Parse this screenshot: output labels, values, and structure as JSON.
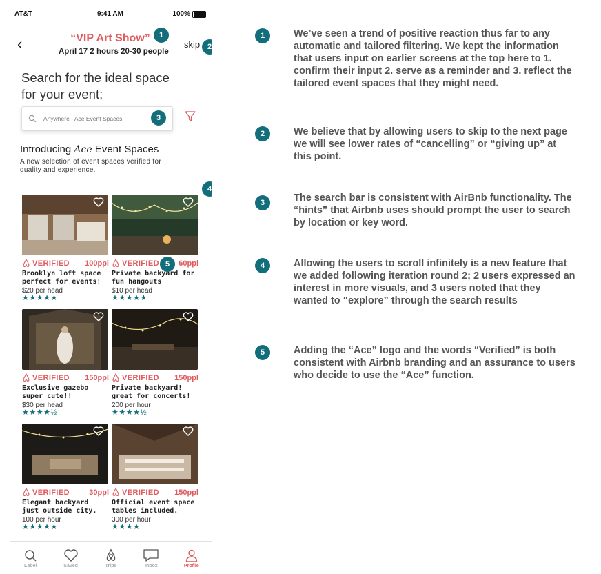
{
  "status": {
    "carrier": "AT&T",
    "time": "9:41 AM",
    "battery": "100%"
  },
  "header": {
    "title": "“VIP Art Show”",
    "subtitle": "April 17   2 hours   20-30 people",
    "skip": "skip"
  },
  "headline": "Search for the ideal space for your event:",
  "search": {
    "placeholder": "Anywhere - Ace Event Spaces"
  },
  "intro": {
    "prefix": "Introducing ",
    "brand": "Ace",
    "suffix": " Event Spaces",
    "description": "A new selection of event spaces verified for quality and experience."
  },
  "markers": {
    "m1": "1",
    "m2": "2",
    "m3": "3",
    "m4": "4",
    "m5": "5"
  },
  "cards": [
    {
      "verified": "VERIFIED",
      "capacity": "100ppl",
      "name": "Brooklyn loft space perfect for events!",
      "price": "$20 per head",
      "stars": "★★★★★"
    },
    {
      "verified": "VERIFIED",
      "capacity": "60ppl",
      "name": "Private backyard for fun hangouts",
      "price": "$10 per head",
      "stars": "★★★★★"
    },
    {
      "verified": "VERIFIED",
      "capacity": "150ppl",
      "name": "Exclusive gazebo super cute!!",
      "price": "$30 per head",
      "stars": "★★★★½"
    },
    {
      "verified": "VERIFIED",
      "capacity": "150ppl",
      "name": "Private backyard! great for concerts!",
      "price": "200 per hour",
      "stars": "★★★★½"
    },
    {
      "verified": "VERIFIED",
      "capacity": "30ppl",
      "name": "Elegant backyard just outside city.",
      "price": "100 per hour",
      "stars": "★★★★★"
    },
    {
      "verified": "VERIFIED",
      "capacity": "150ppl",
      "name": "Official event space tables included.",
      "price": "300 per hour",
      "stars": "★★★★"
    }
  ],
  "tabs": [
    {
      "label": "Label",
      "icon": "search-icon"
    },
    {
      "label": "Saved",
      "icon": "heart-icon"
    },
    {
      "label": "Trips",
      "icon": "airbnb-logo-icon"
    },
    {
      "label": "Inbox",
      "icon": "message-icon"
    },
    {
      "label": "Profile",
      "icon": "profile-icon"
    }
  ],
  "notes": [
    {
      "num": "1",
      "text": "We’ve seen a trend of positive reaction thus far to any automatic and tailored filtering. We kept the information that users input on earlier screens at the top here to 1. confirm their input 2. serve as a reminder and 3. reflect the tailored event spaces that they might need."
    },
    {
      "num": "2",
      "text": "We believe that by allowing users to skip to the next page we will see lower rates of “cancelling” or “giving up” at this point."
    },
    {
      "num": "3",
      "text": "The search bar is consistent with AirBnb functionality. The “hints” that Airbnb uses should prompt the user to search by location or key word."
    },
    {
      "num": "4",
      "text": "Allowing the users to scroll infinitely is a new feature that we added following iteration round 2; 2 users expressed an interest in more visuals, and 3 users noted that they wanted to “explore” through the search results"
    },
    {
      "num": "5",
      "text": "Adding the “Ace” logo and the words “Verified” is both consistent with Airbnb branding and an assurance to users who decide to use the “Ace” function."
    }
  ],
  "colors": {
    "accent": "#e05a5f",
    "teal": "#126e7a",
    "note_text": "#555555"
  }
}
